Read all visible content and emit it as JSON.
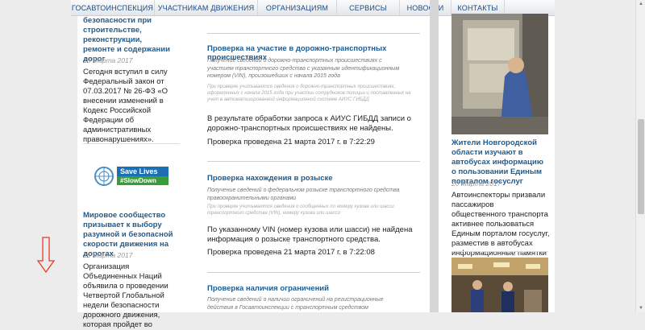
{
  "nav": [
    "ГОСАВТОИНСПЕКЦИЯ",
    "УЧАСТНИКАМ ДВИЖЕНИЯ",
    "ОРГАНИЗАЦИЯМ",
    "СЕРВИСЫ",
    "НОВОСТИ",
    "КОНТАКТЫ"
  ],
  "left": {
    "news1_title": "безопасности при строительстве, реконструкции, ремонте и содержании дорог",
    "news1_date": "18 Марта 2017",
    "news1_text": "Сегодня вступил в силу Федеральный закон от 07.03.2017 № 26-ФЗ «О внесении изменений в Кодекс Российской Федерации об административных правонарушениях».",
    "banner_text1": "Save Lives",
    "banner_text2": "#SlowDown",
    "news2_title": "Мировое сообщество призывает к выбору разумной и безопасной скорости движения на дорогах",
    "news2_date": "16 Марта 2017",
    "news2_text": "Организация Объединенных Наций объявила о проведении Четвертой Глобальной недели безопасности дорожного движения, которая пройдет во"
  },
  "main": {
    "c1_title": "Проверка на участие в дорожно-транспортных происшествиях",
    "c1_desc": "Получение сведений о дорожно-транспортных происшествиях с участием транспортного средства с указанным идентификационным номером (VIN), произошедших с начала 2015 года",
    "c1_note": "При проверке учитываются сведения о дорожно-транспортных происшествиях, оформленных с начала 2015 года при участии сотрудников полиции и поставленных на учет в автоматизированной информационной системе АИУС ГИБДД",
    "c1_result": "В результате обработки запроса к АИУС ГИБДД записи о дорожно-транспортных происшествиях не найдены.",
    "c1_date": "Проверка проведена 21 марта 2017 г. в 7:22:29",
    "c2_title": "Проверка нахождения в розыске",
    "c2_desc": "Получение сведений о федеральном розыске транспортного средства правоохранительными органами",
    "c2_note": "При проверке учитываются сведения о сообщенных по номеру кузова или шасси транспортного средства (VIN), номеру кузова или шасси",
    "c2_result": "По указанному VIN (номер кузова или шасси) не найдена информация о розыске транспортного средства.",
    "c2_date": "Проверка проведена 21 марта 2017 г. в 7:22:08",
    "c3_title": "Проверка наличия ограничений",
    "c3_desc": "Получение сведений о наличии ограничений на регистрационные действия в Госавтоинспекции с транспортным средством"
  },
  "right": {
    "news_title": "Жители Новгородской области изучают в автобусах информацию о пользовании Единым порталом госуслуг",
    "news_date": "20 Марта 2017",
    "news_text": "Автоинспекторы призвали пассажиров общественного транспорта активнее пользоваться Единым порталом госуслуг, разместив в автобусах информационные памятки"
  },
  "colors": {
    "link": "#1b5c93",
    "arrow": "#e23b2e",
    "nav_bg": "#e8ecf0"
  },
  "icons": [
    "un-emblem-icon",
    "down-arrow-icon",
    "scroll-up-icon",
    "scroll-down-icon"
  ]
}
